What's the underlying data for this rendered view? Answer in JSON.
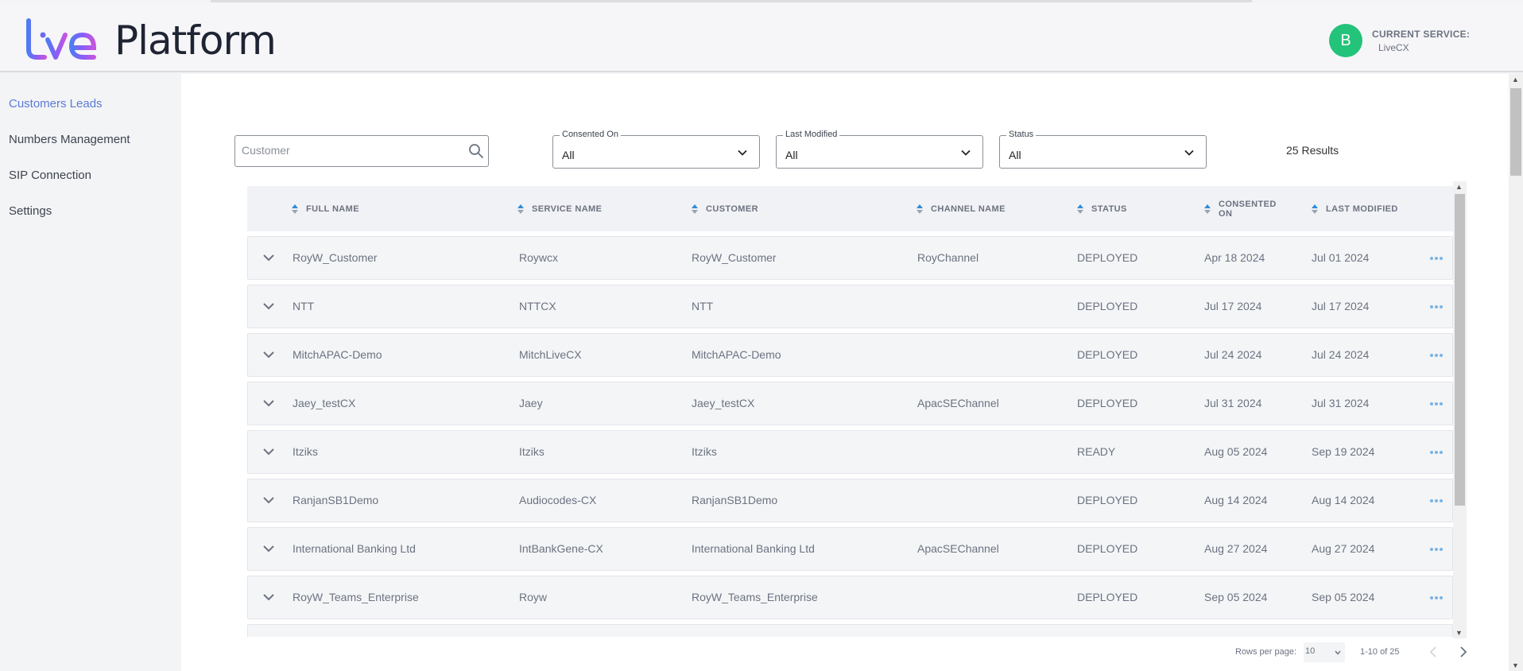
{
  "app": {
    "logo_text": "Platform",
    "logo_mark": "live"
  },
  "header": {
    "avatar_letter": "B",
    "service_label": "CURRENT SERVICE:",
    "service_value": "LiveCX"
  },
  "sidebar": {
    "items": [
      {
        "label": "Customers Leads",
        "active": true
      },
      {
        "label": "Numbers Management",
        "active": false
      },
      {
        "label": "SIP Connection",
        "active": false
      },
      {
        "label": "Settings",
        "active": false
      }
    ]
  },
  "filters": {
    "search_placeholder": "Customer",
    "consented_on": {
      "label": "Consented On",
      "value": "All"
    },
    "last_modified": {
      "label": "Last Modified",
      "value": "All"
    },
    "status": {
      "label": "Status",
      "value": "All"
    },
    "results": "25 Results"
  },
  "table": {
    "columns": [
      "FULL NAME",
      "SERVICE NAME",
      "CUSTOMER",
      "CHANNEL NAME",
      "STATUS",
      "CONSENTED ON",
      "LAST MODIFIED"
    ],
    "rows": [
      {
        "full_name": "RoyW_Customer",
        "service_name": "Roywcx",
        "customer": "RoyW_Customer",
        "channel_name": "RoyChannel",
        "status": "DEPLOYED",
        "consented_on": "Apr 18 2024",
        "last_modified": "Jul 01 2024"
      },
      {
        "full_name": "NTT",
        "service_name": "NTTCX",
        "customer": "NTT",
        "channel_name": "",
        "status": "DEPLOYED",
        "consented_on": "Jul 17 2024",
        "last_modified": "Jul 17 2024"
      },
      {
        "full_name": "MitchAPAC-Demo",
        "service_name": "MitchLiveCX",
        "customer": "MitchAPAC-Demo",
        "channel_name": "",
        "status": "DEPLOYED",
        "consented_on": "Jul 24 2024",
        "last_modified": "Jul 24 2024"
      },
      {
        "full_name": "Jaey_testCX",
        "service_name": "Jaey",
        "customer": "Jaey_testCX",
        "channel_name": "ApacSEChannel",
        "status": "DEPLOYED",
        "consented_on": "Jul 31 2024",
        "last_modified": "Jul 31 2024"
      },
      {
        "full_name": "Itziks",
        "service_name": "Itziks",
        "customer": "Itziks",
        "channel_name": "",
        "status": "READY",
        "consented_on": "Aug 05 2024",
        "last_modified": "Sep 19 2024"
      },
      {
        "full_name": "RanjanSB1Demo",
        "service_name": "Audiocodes-CX",
        "customer": "RanjanSB1Demo",
        "channel_name": "",
        "status": "DEPLOYED",
        "consented_on": "Aug 14 2024",
        "last_modified": "Aug 14 2024"
      },
      {
        "full_name": "International Banking Ltd",
        "service_name": "IntBankGene-CX",
        "customer": "International Banking Ltd",
        "channel_name": "ApacSEChannel",
        "status": "DEPLOYED",
        "consented_on": "Aug 27 2024",
        "last_modified": "Aug 27 2024"
      },
      {
        "full_name": "RoyW_Teams_Enterprise",
        "service_name": "Royw",
        "customer": "RoyW_Teams_Enterprise",
        "channel_name": "",
        "status": "DEPLOYED",
        "consented_on": "Sep 05 2024",
        "last_modified": "Sep 05 2024"
      }
    ]
  },
  "pagination": {
    "rows_per_page_label": "Rows per page:",
    "rows_per_page_value": "10",
    "range": "1-10 of 25"
  },
  "colors": {
    "accent": "#5b7bd5",
    "avatar": "#23c37a",
    "sort_up": "#2e8bd8",
    "more_dots": "#7cb3e6"
  },
  "icons": [
    "search-icon",
    "chevron-down-icon",
    "sort-icon",
    "expand-chevron-icon",
    "more-options-icon",
    "prev-page-icon",
    "next-page-icon"
  ]
}
